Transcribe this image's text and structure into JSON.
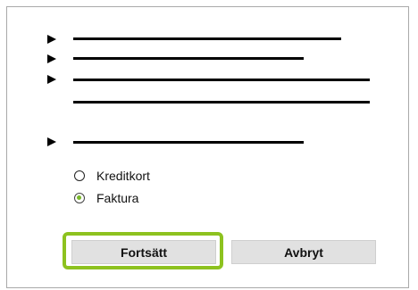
{
  "payment": {
    "options": [
      {
        "label": "Kreditkort",
        "selected": false
      },
      {
        "label": "Faktura",
        "selected": true
      }
    ],
    "accent_color": "#8dc21f",
    "radio_dot_color": "#79b82a"
  },
  "buttons": {
    "continue_label": "Fortsätt",
    "cancel_label": "Avbryt"
  },
  "icons": {
    "bullet": "triangle-right-icon"
  }
}
